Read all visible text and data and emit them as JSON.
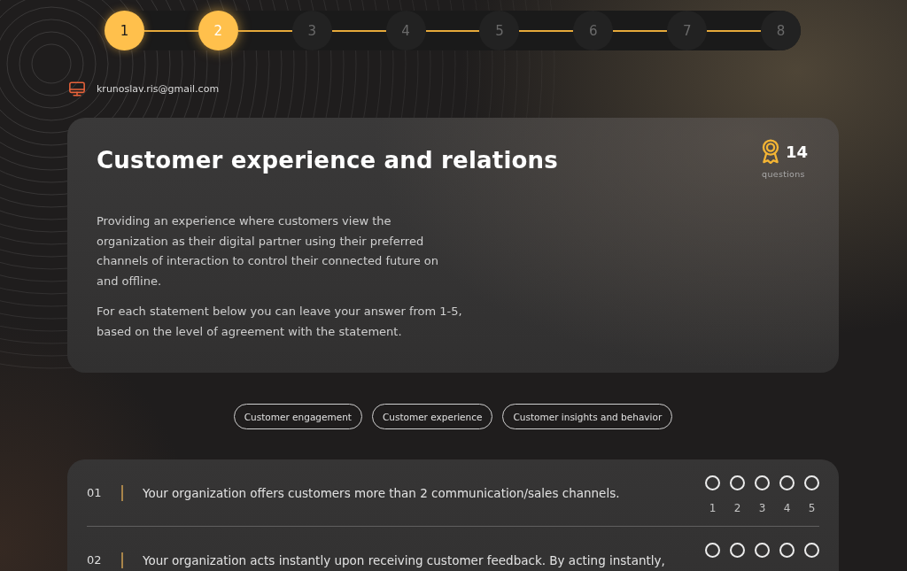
{
  "stepper": {
    "steps": [
      {
        "label": "1",
        "completed": true,
        "selected": false
      },
      {
        "label": "2",
        "completed": false,
        "selected": true
      },
      {
        "label": "3",
        "completed": false,
        "selected": false
      },
      {
        "label": "4",
        "completed": false,
        "selected": false
      },
      {
        "label": "5",
        "completed": false,
        "selected": false
      },
      {
        "label": "6",
        "completed": false,
        "selected": false
      },
      {
        "label": "7",
        "completed": false,
        "selected": false
      },
      {
        "label": "8",
        "completed": false,
        "selected": false
      }
    ]
  },
  "user": {
    "email": "krunoslav.ris@gmail.com"
  },
  "section": {
    "title": "Customer experience and relations",
    "question_count": "14",
    "question_count_label": "questions",
    "description": [
      "Providing an experience where customers view the organization as their digital partner using their preferred channels of interaction to control their connected future on and offline.",
      "For each statement below you can leave your answer from 1-5, based on the level of agreement with the statement."
    ]
  },
  "topics": [
    {
      "label": "Customer engagement",
      "selected": false
    },
    {
      "label": "Customer experience",
      "selected": false
    },
    {
      "label": "Customer insights and behavior",
      "selected": false
    }
  ],
  "questions": [
    {
      "number": "01",
      "text": "Your organization offers customers more than 2 communication/sales channels.",
      "options": [
        {
          "label": "1",
          "selected": false
        },
        {
          "label": "2",
          "selected": false
        },
        {
          "label": "3",
          "selected": false
        },
        {
          "label": "4",
          "selected": false
        },
        {
          "label": "5",
          "selected": false
        }
      ]
    },
    {
      "number": "02",
      "text": "Your organization acts instantly upon receiving customer feedback. By acting instantly,",
      "options": [
        {
          "selected": false
        },
        {
          "selected": false
        },
        {
          "selected": false
        },
        {
          "selected": false
        },
        {
          "selected": false
        }
      ]
    }
  ]
}
